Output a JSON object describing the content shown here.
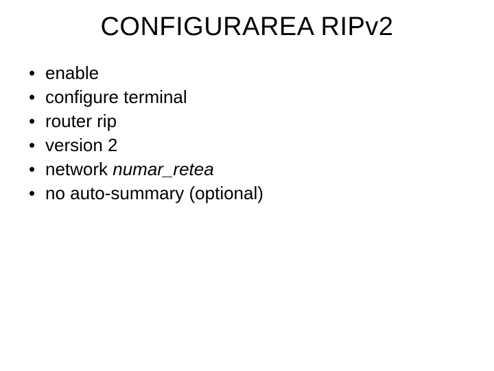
{
  "title": "CONFIGURAREA RIPv2",
  "bullets": [
    {
      "prefix": "enable",
      "italic": "",
      "suffix": ""
    },
    {
      "prefix": "configure terminal",
      "italic": "",
      "suffix": ""
    },
    {
      "prefix": "router rip",
      "italic": "",
      "suffix": ""
    },
    {
      "prefix": "version 2",
      "italic": "",
      "suffix": ""
    },
    {
      "prefix": "network ",
      "italic": "numar_retea",
      "suffix": ""
    },
    {
      "prefix": "no auto-summary (optional)",
      "italic": "",
      "suffix": ""
    }
  ]
}
